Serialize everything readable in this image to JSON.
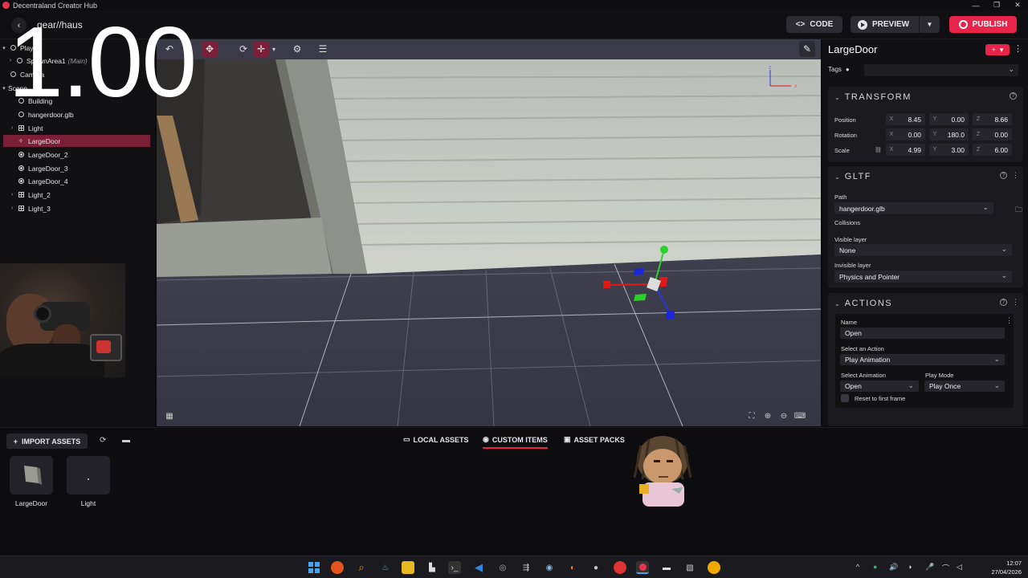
{
  "app": {
    "window_title": "Decentraland Creator Hub"
  },
  "header": {
    "breadcrumb": "gear//haus",
    "code_label": "CODE",
    "preview_label": "PREVIEW",
    "publish_label": "PUBLISH"
  },
  "overlay": {
    "counter": "1.00"
  },
  "tree": {
    "items": [
      {
        "label": "Player",
        "extra": "",
        "depth": 0
      },
      {
        "label": "SpawnArea1",
        "extra": "(Main)",
        "depth": 1
      },
      {
        "label": "Camera",
        "extra": "",
        "depth": 0
      },
      {
        "label": "Scene",
        "extra": "",
        "depth": 0
      },
      {
        "label": "Building",
        "extra": "",
        "depth": 1
      },
      {
        "label": "hangerdoor.glb",
        "extra": "",
        "depth": 1
      },
      {
        "label": "Light",
        "extra": "",
        "depth": 1
      },
      {
        "label": "LargeDoor",
        "extra": "",
        "depth": 1
      },
      {
        "label": "LargeDoor_2",
        "extra": "",
        "depth": 1
      },
      {
        "label": "LargeDoor_3",
        "extra": "",
        "depth": 1
      },
      {
        "label": "LargeDoor_4",
        "extra": "",
        "depth": 1
      },
      {
        "label": "Light_2",
        "extra": "",
        "depth": 1
      },
      {
        "label": "Light_3",
        "extra": "",
        "depth": 1
      }
    ]
  },
  "inspector": {
    "entity_name": "LargeDoor",
    "tags_label": "Tags",
    "transform": {
      "title": "TRANSFORM",
      "position_label": "Position",
      "rotation_label": "Rotation",
      "scale_label": "Scale",
      "axis_x": "X",
      "axis_y": "Y",
      "axis_z": "Z",
      "position": {
        "x": "8.45",
        "y": "0.00",
        "z": "8.66"
      },
      "rotation": {
        "x": "0.00",
        "y": "180.0",
        "z": "0.00"
      },
      "scale": {
        "x": "4.99",
        "y": "3.00",
        "z": "6.00"
      }
    },
    "gltf": {
      "title": "GLTF",
      "path_label": "Path",
      "path_value": "hangerdoor.glb",
      "collisions_label": "Collisions",
      "visible_layer_label": "Visible layer",
      "visible_layer_value": "None",
      "invisible_layer_label": "Invisible layer",
      "invisible_layer_value": "Physics and Pointer"
    },
    "actions": {
      "title": "ACTIONS",
      "name_label": "Name",
      "name_value": "Open",
      "select_action_label": "Select an Action",
      "select_action_value": "Play Animation",
      "select_animation_label": "Select Animation",
      "select_animation_value": "Open",
      "play_mode_label": "Play Mode",
      "play_mode_value": "Play Once",
      "reset_label": "Reset to first frame"
    }
  },
  "assets": {
    "import_label": "IMPORT ASSETS",
    "tabs": [
      {
        "label": "LOCAL ASSETS"
      },
      {
        "label": "CUSTOM ITEMS"
      },
      {
        "label": "ASSET PACKS"
      }
    ],
    "items": [
      {
        "label": "LargeDoor"
      },
      {
        "label": "Light"
      }
    ]
  },
  "taskbar": {
    "time": "12:07",
    "date": "27/04/2026"
  },
  "colors": {
    "accent": "#e8244a",
    "selection": "#7b1f38",
    "panel": "#111114",
    "viewport_floor": "#3a3a48"
  }
}
